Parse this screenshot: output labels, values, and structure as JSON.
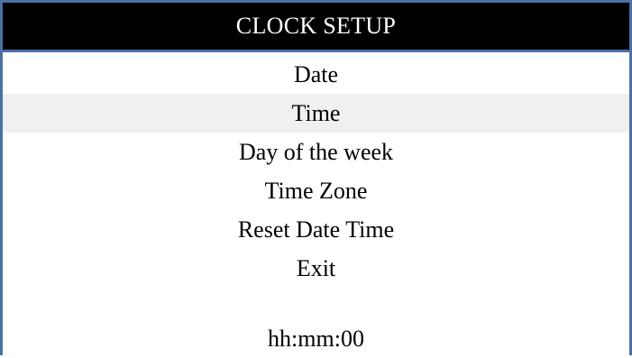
{
  "header": {
    "title": "CLOCK SETUP"
  },
  "menu": {
    "items": [
      {
        "label": "Date",
        "selected": false
      },
      {
        "label": "Time",
        "selected": true
      },
      {
        "label": "Day of the week",
        "selected": false
      },
      {
        "label": "Time Zone",
        "selected": false
      },
      {
        "label": "Reset Date Time",
        "selected": false
      },
      {
        "label": "Exit",
        "selected": false
      }
    ]
  },
  "status": {
    "time_format": "hh:mm:00"
  },
  "colors": {
    "title_bg": "#000000",
    "border": "#4a6fa5",
    "selected_bg": "#f0f0f0"
  }
}
